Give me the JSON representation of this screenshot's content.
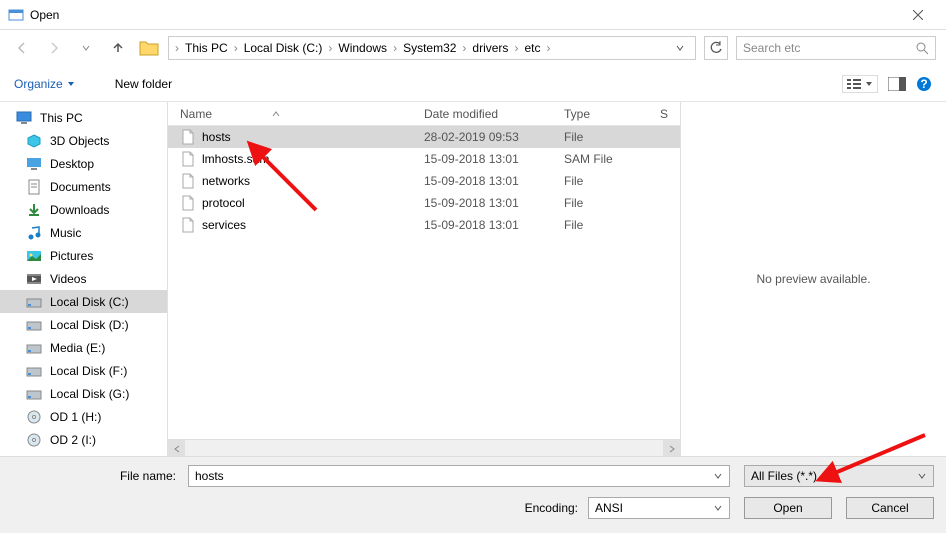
{
  "title": "Open",
  "breadcrumb": [
    "This PC",
    "Local Disk (C:)",
    "Windows",
    "System32",
    "drivers",
    "etc"
  ],
  "search_placeholder": "Search etc",
  "toolbar": {
    "organize": "Organize",
    "newfolder": "New folder"
  },
  "sidebar": {
    "root": "This PC",
    "items": [
      {
        "label": "3D Objects",
        "icon": "3d"
      },
      {
        "label": "Desktop",
        "icon": "desktop"
      },
      {
        "label": "Documents",
        "icon": "docs"
      },
      {
        "label": "Downloads",
        "icon": "downloads"
      },
      {
        "label": "Music",
        "icon": "music"
      },
      {
        "label": "Pictures",
        "icon": "pictures"
      },
      {
        "label": "Videos",
        "icon": "videos"
      },
      {
        "label": "Local Disk (C:)",
        "icon": "disk",
        "selected": true
      },
      {
        "label": "Local Disk (D:)",
        "icon": "disk"
      },
      {
        "label": "Media (E:)",
        "icon": "disk"
      },
      {
        "label": "Local Disk (F:)",
        "icon": "disk"
      },
      {
        "label": "Local Disk (G:)",
        "icon": "disk"
      },
      {
        "label": "OD 1 (H:)",
        "icon": "cd"
      },
      {
        "label": "OD 2 (I:)",
        "icon": "cd"
      }
    ]
  },
  "columns": {
    "name": "Name",
    "date": "Date modified",
    "type": "Type",
    "size": "S"
  },
  "files": [
    {
      "name": "hosts",
      "date": "28-02-2019 09:53",
      "type": "File",
      "selected": true
    },
    {
      "name": "lmhosts.sam",
      "date": "15-09-2018 13:01",
      "type": "SAM File"
    },
    {
      "name": "networks",
      "date": "15-09-2018 13:01",
      "type": "File"
    },
    {
      "name": "protocol",
      "date": "15-09-2018 13:01",
      "type": "File"
    },
    {
      "name": "services",
      "date": "15-09-2018 13:01",
      "type": "File"
    }
  ],
  "preview_text": "No preview available.",
  "bottom": {
    "filename_label": "File name:",
    "filename_value": "hosts",
    "filter": "All Files  (*.*)",
    "encoding_label": "Encoding:",
    "encoding_value": "ANSI",
    "open": "Open",
    "cancel": "Cancel"
  }
}
